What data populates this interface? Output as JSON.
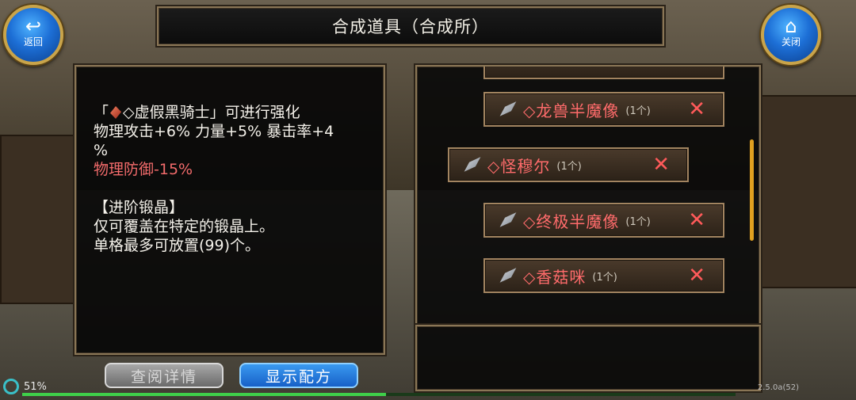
{
  "header": {
    "title": "合成道具（合成所）",
    "back_label": "返回",
    "close_label": "关闭"
  },
  "info": {
    "lines": [
      "「◇虚假黑骑士」可进行强化",
      "物理攻击+6% 力量+5% 暴击率+4",
      "%",
      "物理防御-15%",
      "【进阶锻晶】",
      "仅可覆盖在特定的锻晶上。",
      "单格最多可放置(99)个。"
    ],
    "line1_prefix": "「",
    "line1_name": "◇虚假黑骑士",
    "line1_suffix": "」可进行强化",
    "negative_color": "#f26b6b"
  },
  "ingredients": [
    {
      "name": "◇龙兽半魔像",
      "count": "(1个)",
      "remove": "✕"
    },
    {
      "name": "◇怪穆尔",
      "count": "(1个)",
      "remove": "✕"
    },
    {
      "name": "◇终极半魔像",
      "count": "(1个)",
      "remove": "✕"
    },
    {
      "name": "◇香菇咪",
      "count": "(1个)",
      "remove": "✕"
    }
  ],
  "buttons": {
    "view_details": "查阅详情",
    "show_recipe": "显示配方"
  },
  "status": {
    "progress_text": "51%",
    "progress_fraction": 0.51,
    "version": "2.5.0a(52)"
  },
  "colors": {
    "ingredient_name": "#ff6b6b",
    "accent_blue": "#1d6fd6",
    "frame_gold": "#8a7656"
  }
}
